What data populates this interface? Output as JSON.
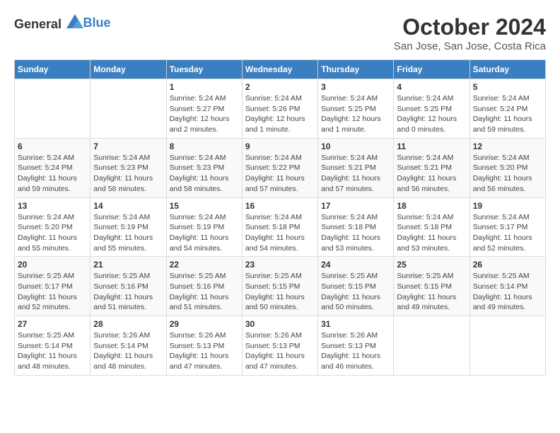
{
  "header": {
    "logo": {
      "general": "General",
      "blue": "Blue"
    },
    "title": "October 2024",
    "location": "San Jose, San Jose, Costa Rica"
  },
  "calendar": {
    "days_header": [
      "Sunday",
      "Monday",
      "Tuesday",
      "Wednesday",
      "Thursday",
      "Friday",
      "Saturday"
    ],
    "weeks": [
      [
        {
          "day": "",
          "info": ""
        },
        {
          "day": "",
          "info": ""
        },
        {
          "day": "1",
          "info": "Sunrise: 5:24 AM\nSunset: 5:27 PM\nDaylight: 12 hours\nand 2 minutes."
        },
        {
          "day": "2",
          "info": "Sunrise: 5:24 AM\nSunset: 5:26 PM\nDaylight: 12 hours\nand 1 minute."
        },
        {
          "day": "3",
          "info": "Sunrise: 5:24 AM\nSunset: 5:25 PM\nDaylight: 12 hours\nand 1 minute."
        },
        {
          "day": "4",
          "info": "Sunrise: 5:24 AM\nSunset: 5:25 PM\nDaylight: 12 hours\nand 0 minutes."
        },
        {
          "day": "5",
          "info": "Sunrise: 5:24 AM\nSunset: 5:24 PM\nDaylight: 11 hours\nand 59 minutes."
        }
      ],
      [
        {
          "day": "6",
          "info": "Sunrise: 5:24 AM\nSunset: 5:24 PM\nDaylight: 11 hours\nand 59 minutes."
        },
        {
          "day": "7",
          "info": "Sunrise: 5:24 AM\nSunset: 5:23 PM\nDaylight: 11 hours\nand 58 minutes."
        },
        {
          "day": "8",
          "info": "Sunrise: 5:24 AM\nSunset: 5:23 PM\nDaylight: 11 hours\nand 58 minutes."
        },
        {
          "day": "9",
          "info": "Sunrise: 5:24 AM\nSunset: 5:22 PM\nDaylight: 11 hours\nand 57 minutes."
        },
        {
          "day": "10",
          "info": "Sunrise: 5:24 AM\nSunset: 5:21 PM\nDaylight: 11 hours\nand 57 minutes."
        },
        {
          "day": "11",
          "info": "Sunrise: 5:24 AM\nSunset: 5:21 PM\nDaylight: 11 hours\nand 56 minutes."
        },
        {
          "day": "12",
          "info": "Sunrise: 5:24 AM\nSunset: 5:20 PM\nDaylight: 11 hours\nand 56 minutes."
        }
      ],
      [
        {
          "day": "13",
          "info": "Sunrise: 5:24 AM\nSunset: 5:20 PM\nDaylight: 11 hours\nand 55 minutes."
        },
        {
          "day": "14",
          "info": "Sunrise: 5:24 AM\nSunset: 5:19 PM\nDaylight: 11 hours\nand 55 minutes."
        },
        {
          "day": "15",
          "info": "Sunrise: 5:24 AM\nSunset: 5:19 PM\nDaylight: 11 hours\nand 54 minutes."
        },
        {
          "day": "16",
          "info": "Sunrise: 5:24 AM\nSunset: 5:18 PM\nDaylight: 11 hours\nand 54 minutes."
        },
        {
          "day": "17",
          "info": "Sunrise: 5:24 AM\nSunset: 5:18 PM\nDaylight: 11 hours\nand 53 minutes."
        },
        {
          "day": "18",
          "info": "Sunrise: 5:24 AM\nSunset: 5:18 PM\nDaylight: 11 hours\nand 53 minutes."
        },
        {
          "day": "19",
          "info": "Sunrise: 5:24 AM\nSunset: 5:17 PM\nDaylight: 11 hours\nand 52 minutes."
        }
      ],
      [
        {
          "day": "20",
          "info": "Sunrise: 5:25 AM\nSunset: 5:17 PM\nDaylight: 11 hours\nand 52 minutes."
        },
        {
          "day": "21",
          "info": "Sunrise: 5:25 AM\nSunset: 5:16 PM\nDaylight: 11 hours\nand 51 minutes."
        },
        {
          "day": "22",
          "info": "Sunrise: 5:25 AM\nSunset: 5:16 PM\nDaylight: 11 hours\nand 51 minutes."
        },
        {
          "day": "23",
          "info": "Sunrise: 5:25 AM\nSunset: 5:15 PM\nDaylight: 11 hours\nand 50 minutes."
        },
        {
          "day": "24",
          "info": "Sunrise: 5:25 AM\nSunset: 5:15 PM\nDaylight: 11 hours\nand 50 minutes."
        },
        {
          "day": "25",
          "info": "Sunrise: 5:25 AM\nSunset: 5:15 PM\nDaylight: 11 hours\nand 49 minutes."
        },
        {
          "day": "26",
          "info": "Sunrise: 5:25 AM\nSunset: 5:14 PM\nDaylight: 11 hours\nand 49 minutes."
        }
      ],
      [
        {
          "day": "27",
          "info": "Sunrise: 5:25 AM\nSunset: 5:14 PM\nDaylight: 11 hours\nand 48 minutes."
        },
        {
          "day": "28",
          "info": "Sunrise: 5:26 AM\nSunset: 5:14 PM\nDaylight: 11 hours\nand 48 minutes."
        },
        {
          "day": "29",
          "info": "Sunrise: 5:26 AM\nSunset: 5:13 PM\nDaylight: 11 hours\nand 47 minutes."
        },
        {
          "day": "30",
          "info": "Sunrise: 5:26 AM\nSunset: 5:13 PM\nDaylight: 11 hours\nand 47 minutes."
        },
        {
          "day": "31",
          "info": "Sunrise: 5:26 AM\nSunset: 5:13 PM\nDaylight: 11 hours\nand 46 minutes."
        },
        {
          "day": "",
          "info": ""
        },
        {
          "day": "",
          "info": ""
        }
      ]
    ]
  }
}
